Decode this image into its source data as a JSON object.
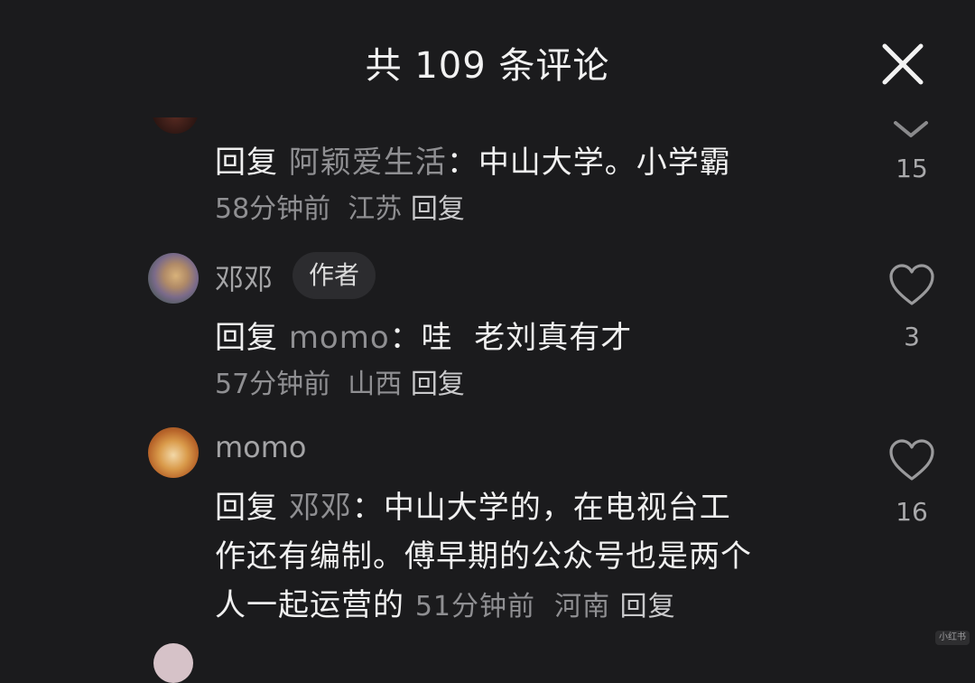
{
  "header": {
    "title": "共 109 条评论"
  },
  "comments": [
    {
      "reply_word": "回复",
      "target": "阿颖爱生活",
      "colon": "：",
      "text": "中山大学。小学霸",
      "time": "58分钟前",
      "location": "江苏",
      "reply_label": "回复",
      "likes": "15"
    },
    {
      "name": "邓邓",
      "badge": "作者",
      "reply_word": "回复",
      "target": "momo",
      "colon": "：",
      "text": "哇  老刘真有才",
      "time": "57分钟前",
      "location": "山西",
      "reply_label": "回复",
      "likes": "3"
    },
    {
      "name": "momo",
      "reply_word": "回复",
      "target": "邓邓",
      "colon": "：",
      "text_line1": "中山大学的，在电视台工",
      "text_line2": "作还有编制。傅早期的公众号也是两个",
      "text_line3": "人一起运营的",
      "time": "51分钟前",
      "location": "河南",
      "reply_label": "回复",
      "likes": "16"
    }
  ],
  "watermark": "小红书",
  "icons": {
    "close": "close-icon",
    "heart": "heart-icon",
    "chevron": "chevron-down-icon"
  },
  "colors": {
    "background": "#1b1b1d",
    "text": "#f0f0f0",
    "muted": "#8f8f92"
  }
}
